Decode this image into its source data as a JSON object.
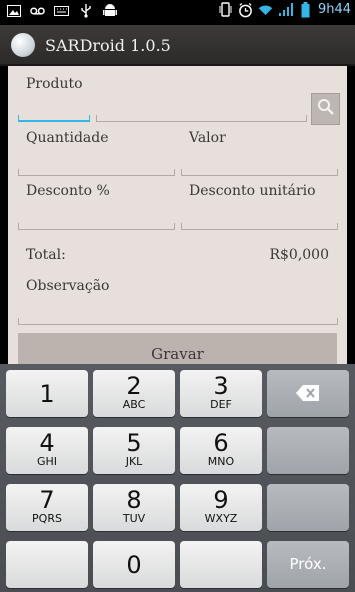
{
  "status_bar": {
    "time": "9h44",
    "icons": [
      "image-icon",
      "voicemail-icon",
      "keyboard-icon",
      "usb-icon",
      "android-icon",
      "vibrate-icon",
      "alarm-icon",
      "wifi-icon",
      "signal-icon",
      "battery-icon"
    ]
  },
  "app": {
    "title": "SARDroid 1.0.5"
  },
  "form": {
    "produto_label": "Produto",
    "quantidade_label": "Quantidade",
    "valor_label": "Valor",
    "desconto_pct_label": "Desconto %",
    "desconto_unit_label": "Desconto unitário",
    "total_label": "Total:",
    "total_value": "R$0,000",
    "observacao_label": "Observação",
    "gravar_label": "Gravar"
  },
  "keyboard": {
    "keys": [
      {
        "num": "1",
        "letters": ""
      },
      {
        "num": "2",
        "letters": "ABC"
      },
      {
        "num": "3",
        "letters": "DEF"
      },
      {
        "num": "4",
        "letters": "GHI"
      },
      {
        "num": "5",
        "letters": "JKL"
      },
      {
        "num": "6",
        "letters": "MNO"
      },
      {
        "num": "7",
        "letters": "PQRS"
      },
      {
        "num": "8",
        "letters": "TUV"
      },
      {
        "num": "9",
        "letters": "WXYZ"
      },
      {
        "num": "0",
        "letters": ""
      }
    ],
    "next_label": "Próx."
  },
  "colors": {
    "focus": "#33b5e5",
    "form_bg": "#e6dfdb",
    "status_time": "#8fd3ff"
  }
}
